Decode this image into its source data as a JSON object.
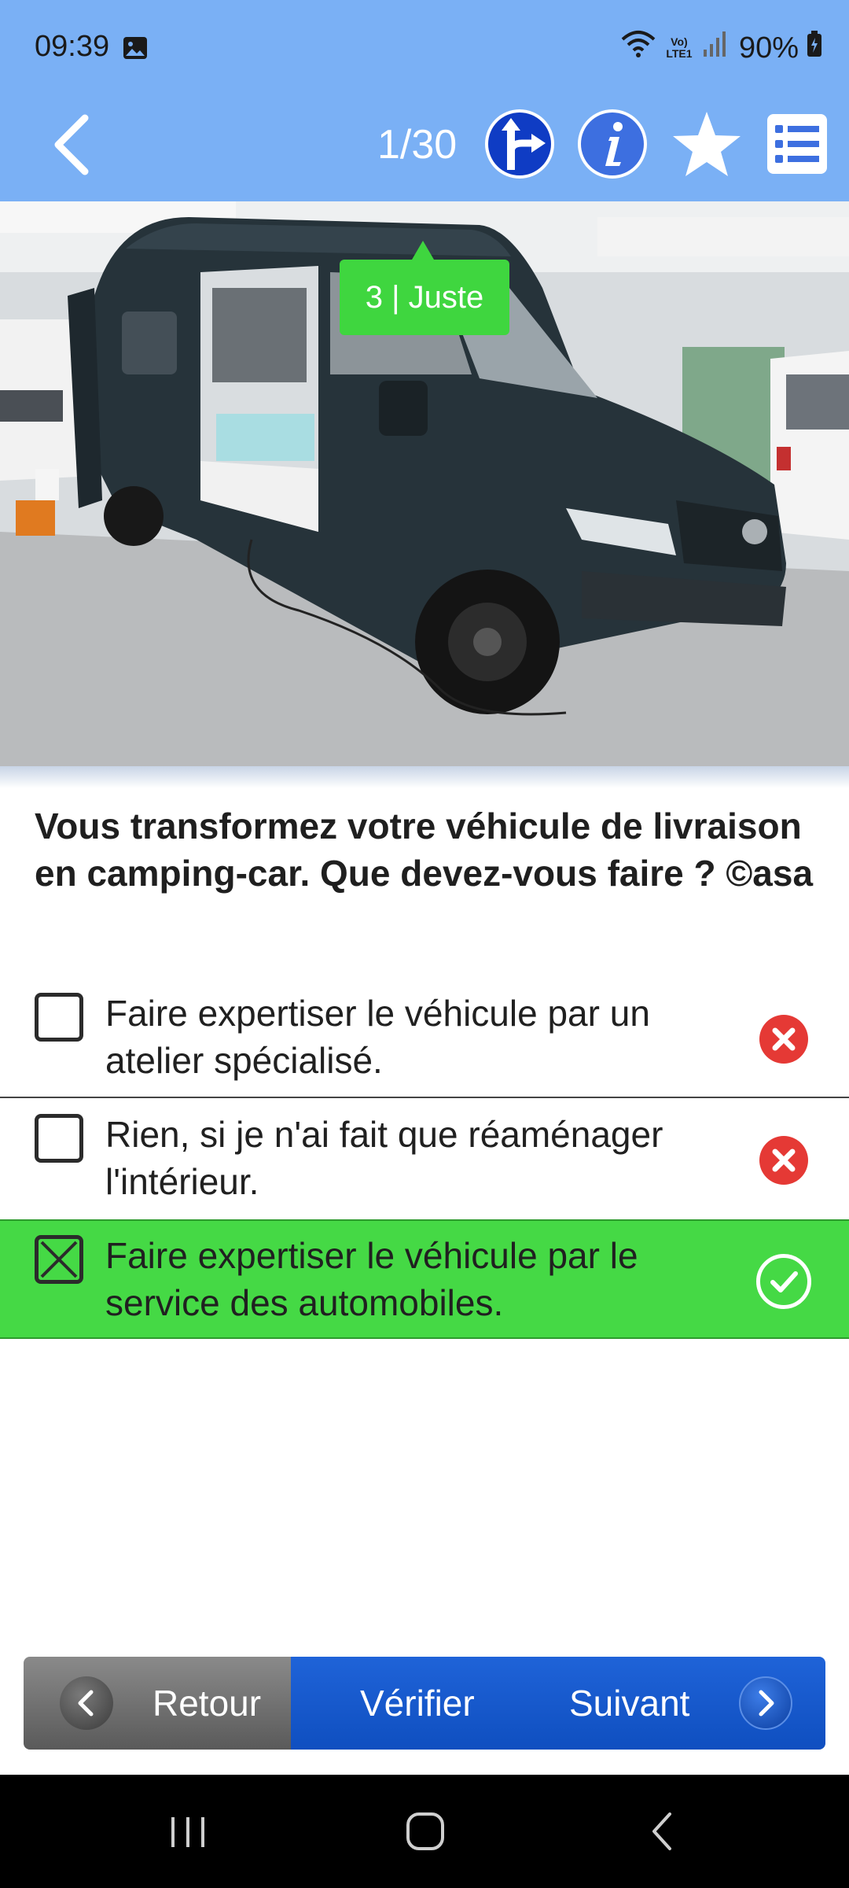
{
  "status_bar": {
    "time": "09:39",
    "network_label": "Vo) LTE1",
    "battery": "90%",
    "icons": [
      "image-icon",
      "wifi-icon",
      "volte-icon",
      "signal-icon",
      "battery-icon"
    ]
  },
  "toolbar": {
    "back_icon": "chevron-left-icon",
    "counter": "1/30",
    "buttons": [
      "road-sign-icon",
      "info-icon",
      "star-icon",
      "list-icon"
    ]
  },
  "photo": {
    "badge": "3 | Juste"
  },
  "question": {
    "text": "Vous transformez votre véhicule de livraison en camping-car. Que devez-vous faire ? ©asa"
  },
  "answers": [
    {
      "text": "Faire expertiser le véhicule par un atelier spécialisé.",
      "checked": false,
      "result": "wrong"
    },
    {
      "text": "Rien, si je n'ai fait que réaménager l'intérieur.",
      "checked": false,
      "result": "wrong"
    },
    {
      "text": "Faire expertiser le véhicule par le service des automobiles.",
      "checked": true,
      "result": "correct"
    }
  ],
  "bottom_nav": {
    "retour": "Retour",
    "verifier": "Vérifier",
    "suivant": "Suivant"
  },
  "colors": {
    "header_blue": "#7ab0f5",
    "correct_green": "#45d945",
    "wrong_red": "#e53935",
    "primary_blue": "#1a5cd0"
  }
}
